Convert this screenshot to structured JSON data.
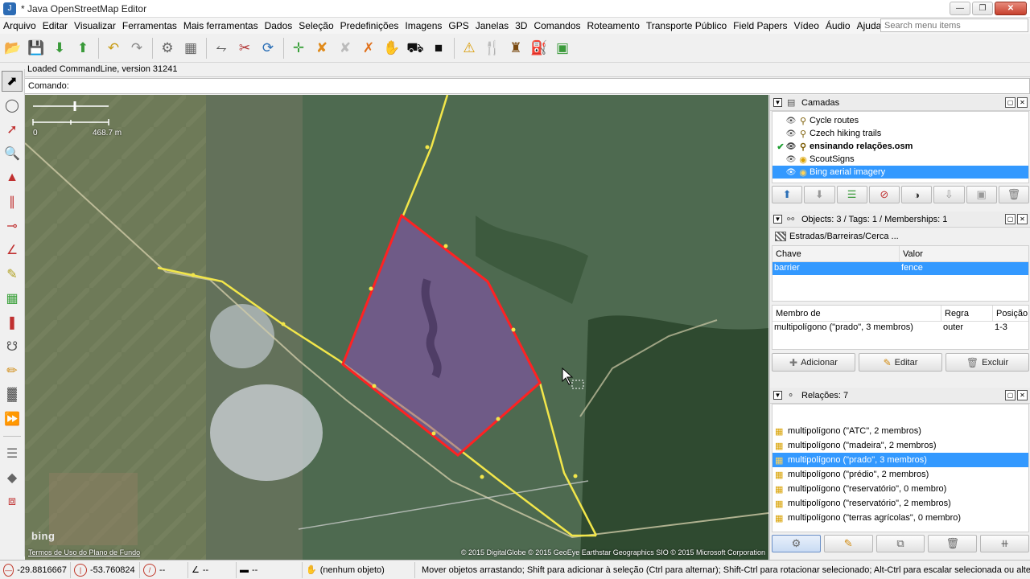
{
  "window": {
    "title": "* Java OpenStreetMap Editor"
  },
  "menu": {
    "items": [
      "Arquivo",
      "Editar",
      "Visualizar",
      "Ferramentas",
      "Mais ferramentas",
      "Dados",
      "Seleção",
      "Predefinições",
      "Imagens",
      "GPS",
      "Janelas",
      "3D",
      "Comandos",
      "Roteamento",
      "Transporte Público",
      "Field Papers",
      "Vídeo",
      "Áudio",
      "Ajuda"
    ],
    "search_placeholder": "Search menu items"
  },
  "toolbar": {
    "icons": [
      "open-file-icon",
      "save-icon",
      "download-icon",
      "upload-icon",
      "undo-icon",
      "redo-icon",
      "preferences-icon",
      "tag-editor-icon",
      "merge-icon",
      "split-way-icon",
      "refresh-icon",
      "orthogonalize-icon",
      "select-tool-icon",
      "no-entry-icon",
      "cross-icon",
      "hand-icon",
      "car-icon",
      "bus-icon",
      "warning-icon",
      "restaurant-icon",
      "castle-icon",
      "factory-icon",
      "save-layer-icon"
    ]
  },
  "command": {
    "loaded_text": "Loaded CommandLine, version 31241",
    "label": "Comando:"
  },
  "left_tools": [
    "select-icon",
    "lasso-icon",
    "draw-icon",
    "zoom-icon",
    "building-icon",
    "parallel-icon",
    "split-icon",
    "measure-icon",
    "improve-way-icon",
    "bridge-icon",
    "tag-icon",
    "pencil-icon",
    "relation-icon",
    "more-icon",
    "layer-toggle-icon",
    "filter-icon",
    "map-paint-icon",
    "fullscreen-icon"
  ],
  "map": {
    "scale_zero": "0",
    "scale_dist": "468.7 m",
    "bing_logo": "bing",
    "terms": "Termos de Uso do Plano de Fundo",
    "attribution": "© 2015 DigitalGlobe © 2015 GeoEye Earthstar Geographics SIO © 2015 Microsoft Corporation",
    "colors": {
      "selected_line": "#ff2222",
      "road": "#f2e64a",
      "fill": "#8a4fb5"
    }
  },
  "layers": {
    "title": "Camadas",
    "items": [
      {
        "name": "Cycle routes",
        "visible": true,
        "active": false,
        "selected": false,
        "bold": false,
        "icon": "wms-icon"
      },
      {
        "name": "Czech hiking trails",
        "visible": true,
        "active": false,
        "selected": false,
        "bold": false,
        "icon": "wms-icon"
      },
      {
        "name": "ensinando relações.osm",
        "visible": true,
        "active": true,
        "selected": false,
        "bold": true,
        "icon": "osm-icon"
      },
      {
        "name": "ScoutSigns",
        "visible": true,
        "active": false,
        "selected": false,
        "bold": false,
        "icon": "scout-icon"
      },
      {
        "name": "Bing aerial imagery",
        "visible": true,
        "active": false,
        "selected": true,
        "bold": false,
        "icon": "bing-icon"
      }
    ],
    "buttons": [
      "move-up-icon",
      "move-down-icon",
      "activate-icon",
      "show-hide-icon",
      "opacity-icon",
      "merge-icon",
      "duplicate-icon",
      "delete-icon"
    ]
  },
  "objects": {
    "title": "Objects: 3 / Tags: 1 / Memberships: 1",
    "preset": "Estradas/Barreiras/Cerca ...",
    "columns": {
      "key": "Chave",
      "value": "Valor"
    },
    "tags": [
      {
        "key": "barrier",
        "value": "fence"
      }
    ],
    "membership_columns": {
      "member": "Membro de",
      "role": "Regra",
      "position": "Posição"
    },
    "memberships": [
      {
        "member": "multipolígono (\"prado\", 3 membros)",
        "role": "outer",
        "position": "1-3"
      }
    ],
    "buttons": {
      "add": "Adicionar",
      "edit": "Editar",
      "delete": "Excluir"
    }
  },
  "relations": {
    "title": "Relações: 7",
    "items": [
      {
        "label": "multipolígono (\"ATC\", 2 membros)",
        "selected": false
      },
      {
        "label": "multipolígono (\"madeira\", 2 membros)",
        "selected": false
      },
      {
        "label": "multipolígono (\"prado\", 3 membros)",
        "selected": true
      },
      {
        "label": "multipolígono (\"prédio\", 2 membros)",
        "selected": false
      },
      {
        "label": "multipolígono (\"reservatório\", 0 membro)",
        "selected": false
      },
      {
        "label": "multipolígono (\"reservatório\", 2 membros)",
        "selected": false
      },
      {
        "label": "multipolígono (\"terras agrícolas\", 0 membro)",
        "selected": false
      }
    ],
    "buttons": [
      "new-relation-icon",
      "edit-relation-icon",
      "duplicate-relation-icon",
      "delete-relation-icon",
      "select-members-icon"
    ]
  },
  "status": {
    "lat": "-29.8816667",
    "lon": "-53.760824",
    "heading": "--",
    "angle": "--",
    "length": "--",
    "selection": "(nenhum objeto)",
    "message": "Mover objetos arrastando; Shift para adicionar à seleção (Ctrl para alternar); Shift-Ctrl para rotacionar selecionado; Alt-Ctrl para escalar selecionada ou alterar seleção"
  }
}
